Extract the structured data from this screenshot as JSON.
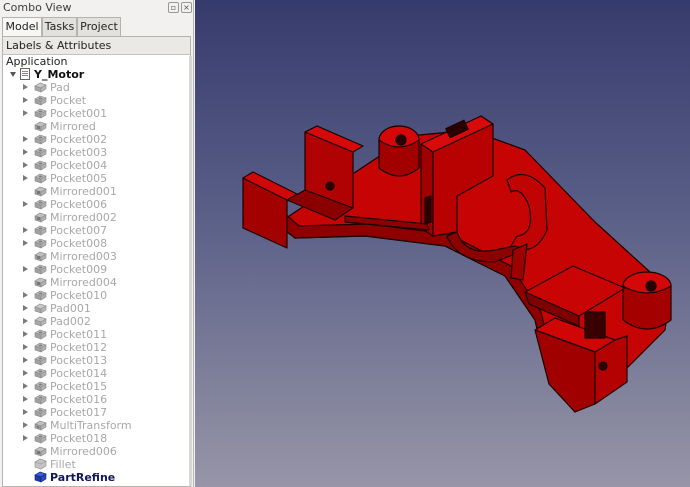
{
  "window": {
    "title": "Combo View",
    "float_icon": "float-icon",
    "close_icon": "close-icon"
  },
  "tabs": [
    {
      "label": "Model",
      "active": true
    },
    {
      "label": "Tasks",
      "active": false
    },
    {
      "label": "Project",
      "active": false
    }
  ],
  "tree": {
    "header": "Labels & Attributes",
    "application_label": "Application",
    "document": {
      "label": "Y_Motor",
      "icon": "document-icon",
      "expanded": true
    },
    "items": [
      {
        "label": "Pad",
        "icon": "pad-icon",
        "expandable": true
      },
      {
        "label": "Pocket",
        "icon": "pocket-icon",
        "expandable": true
      },
      {
        "label": "Pocket001",
        "icon": "pocket-icon",
        "expandable": true
      },
      {
        "label": "Mirrored",
        "icon": "mirrored-icon",
        "expandable": false
      },
      {
        "label": "Pocket002",
        "icon": "pocket-icon",
        "expandable": true
      },
      {
        "label": "Pocket003",
        "icon": "pocket-icon",
        "expandable": true
      },
      {
        "label": "Pocket004",
        "icon": "pocket-icon",
        "expandable": true
      },
      {
        "label": "Pocket005",
        "icon": "pocket-icon",
        "expandable": true
      },
      {
        "label": "Mirrored001",
        "icon": "mirrored-icon",
        "expandable": false
      },
      {
        "label": "Pocket006",
        "icon": "pocket-icon",
        "expandable": true
      },
      {
        "label": "Mirrored002",
        "icon": "mirrored-icon",
        "expandable": false
      },
      {
        "label": "Pocket007",
        "icon": "pocket-icon",
        "expandable": true
      },
      {
        "label": "Pocket008",
        "icon": "pocket-icon",
        "expandable": true
      },
      {
        "label": "Mirrored003",
        "icon": "mirrored-icon",
        "expandable": false
      },
      {
        "label": "Pocket009",
        "icon": "pocket-icon",
        "expandable": true
      },
      {
        "label": "Mirrored004",
        "icon": "mirrored-icon",
        "expandable": false
      },
      {
        "label": "Pocket010",
        "icon": "pocket-icon",
        "expandable": true
      },
      {
        "label": "Pad001",
        "icon": "pad-icon",
        "expandable": true
      },
      {
        "label": "Pad002",
        "icon": "pad-icon",
        "expandable": true
      },
      {
        "label": "Pocket011",
        "icon": "pocket-icon",
        "expandable": true
      },
      {
        "label": "Pocket012",
        "icon": "pocket-icon",
        "expandable": true
      },
      {
        "label": "Pocket013",
        "icon": "pocket-icon",
        "expandable": true
      },
      {
        "label": "Pocket014",
        "icon": "pocket-icon",
        "expandable": true
      },
      {
        "label": "Pocket015",
        "icon": "pocket-icon",
        "expandable": true
      },
      {
        "label": "Pocket016",
        "icon": "pocket-icon",
        "expandable": true
      },
      {
        "label": "Pocket017",
        "icon": "pocket-icon",
        "expandable": true
      },
      {
        "label": "MultiTransform",
        "icon": "multitransform-icon",
        "expandable": true
      },
      {
        "label": "Pocket018",
        "icon": "pocket-icon",
        "expandable": true
      },
      {
        "label": "Mirrored006",
        "icon": "mirrored-icon",
        "expandable": false
      },
      {
        "label": "Fillet",
        "icon": "fillet-icon",
        "expandable": false
      },
      {
        "label": "PartRefine",
        "icon": "partrefine-icon",
        "expandable": false,
        "active": true
      }
    ]
  },
  "viewport": {
    "model_color": "#c20000",
    "edge_color": "#1a0000",
    "background_top": "#363b6d",
    "background_bottom": "#9795a7"
  }
}
